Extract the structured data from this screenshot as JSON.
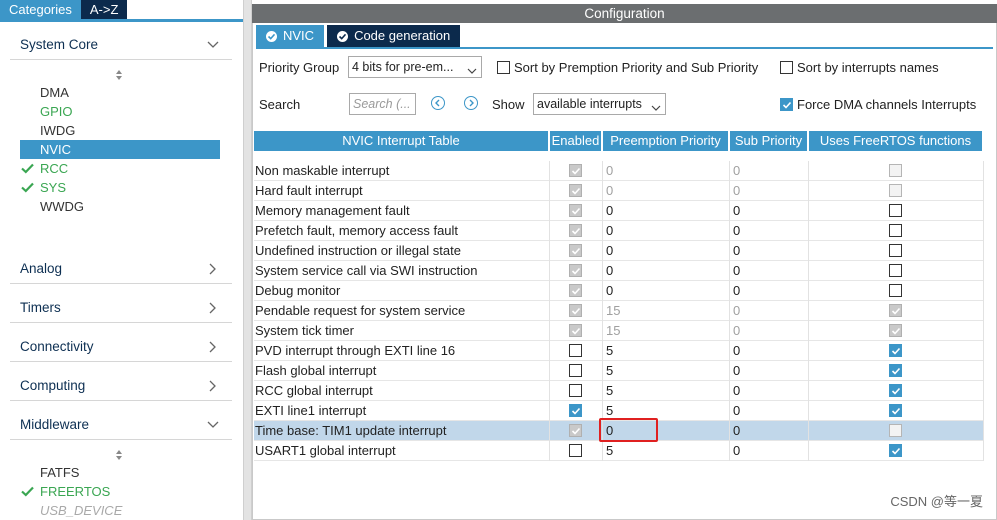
{
  "left": {
    "tabs": [
      "Categories",
      "A->Z"
    ],
    "system_core": {
      "label": "System Core",
      "items": [
        {
          "label": "DMA",
          "state": "normal"
        },
        {
          "label": "GPIO",
          "state": "green"
        },
        {
          "label": "IWDG",
          "state": "normal"
        },
        {
          "label": "NVIC",
          "state": "selected"
        },
        {
          "label": "RCC",
          "state": "green-check"
        },
        {
          "label": "SYS",
          "state": "green-check"
        },
        {
          "label": "WWDG",
          "state": "normal"
        }
      ]
    },
    "groups": [
      "Analog",
      "Timers",
      "Connectivity",
      "Computing"
    ],
    "middleware": {
      "label": "Middleware",
      "items": [
        {
          "label": "FATFS",
          "state": "normal"
        },
        {
          "label": "FREERTOS",
          "state": "green-check"
        },
        {
          "label": "USB_DEVICE",
          "state": "disabled"
        }
      ]
    }
  },
  "config": {
    "title": "Configuration",
    "tabs": [
      "NVIC",
      "Code generation"
    ],
    "priority_group_label": "Priority Group",
    "priority_group_value": "4 bits for pre-em...",
    "sort_preemption_label": "Sort by Premption Priority and Sub Priority",
    "sort_names_label": "Sort by interrupts names",
    "search_label": "Search",
    "search_placeholder": "Search (...",
    "show_label": "Show",
    "show_value": "available interrupts",
    "force_dma_label": "Force DMA channels Interrupts",
    "force_dma_checked": true
  },
  "table": {
    "headers": [
      "NVIC Interrupt Table",
      "Enabled",
      "Preemption Priority",
      "Sub Priority",
      "Uses FreeRTOS functions"
    ],
    "rows": [
      {
        "name": "Non maskable interrupt",
        "enabled": "checked-gray",
        "pre": "0",
        "sub": "0",
        "gray": true,
        "rtos": "empty-gray"
      },
      {
        "name": "Hard fault interrupt",
        "enabled": "checked-gray",
        "pre": "0",
        "sub": "0",
        "gray": true,
        "rtos": "empty-gray"
      },
      {
        "name": "Memory management fault",
        "enabled": "checked-gray",
        "pre": "0",
        "sub": "0",
        "gray": false,
        "rtos": "empty"
      },
      {
        "name": "Prefetch fault, memory access fault",
        "enabled": "checked-gray",
        "pre": "0",
        "sub": "0",
        "gray": false,
        "rtos": "empty"
      },
      {
        "name": "Undefined instruction or illegal state",
        "enabled": "checked-gray",
        "pre": "0",
        "sub": "0",
        "gray": false,
        "rtos": "empty"
      },
      {
        "name": "System service call via SWI instruction",
        "enabled": "checked-gray",
        "pre": "0",
        "sub": "0",
        "gray": false,
        "rtos": "empty"
      },
      {
        "name": "Debug monitor",
        "enabled": "checked-gray",
        "pre": "0",
        "sub": "0",
        "gray": false,
        "rtos": "empty"
      },
      {
        "name": "Pendable request for system service",
        "enabled": "checked-gray",
        "pre": "15",
        "sub": "0",
        "gray": true,
        "rtos": "checked-gray"
      },
      {
        "name": "System tick timer",
        "enabled": "checked-gray",
        "pre": "15",
        "sub": "0",
        "gray": true,
        "rtos": "checked-gray"
      },
      {
        "name": "PVD interrupt through EXTI line 16",
        "enabled": "empty",
        "pre": "5",
        "sub": "0",
        "gray": false,
        "rtos": "checked"
      },
      {
        "name": "Flash global interrupt",
        "enabled": "empty",
        "pre": "5",
        "sub": "0",
        "gray": false,
        "rtos": "checked"
      },
      {
        "name": "RCC global interrupt",
        "enabled": "empty",
        "pre": "5",
        "sub": "0",
        "gray": false,
        "rtos": "checked"
      },
      {
        "name": "EXTI line1 interrupt",
        "enabled": "checked",
        "pre": "5",
        "sub": "0",
        "gray": false,
        "rtos": "checked"
      },
      {
        "name": "Time base: TIM1 update interrupt",
        "enabled": "checked-gray",
        "pre": "0",
        "sub": "0",
        "gray": false,
        "rtos": "empty-gray",
        "selected": true
      },
      {
        "name": "USART1 global interrupt",
        "enabled": "empty",
        "pre": "5",
        "sub": "0",
        "gray": false,
        "rtos": "checked"
      }
    ]
  },
  "watermark": "CSDN @等一夏",
  "colors": {
    "accent": "#3c96c8",
    "dark_tab": "#0c2a4c",
    "green": "#3aa652",
    "highlight": "#e02020"
  }
}
